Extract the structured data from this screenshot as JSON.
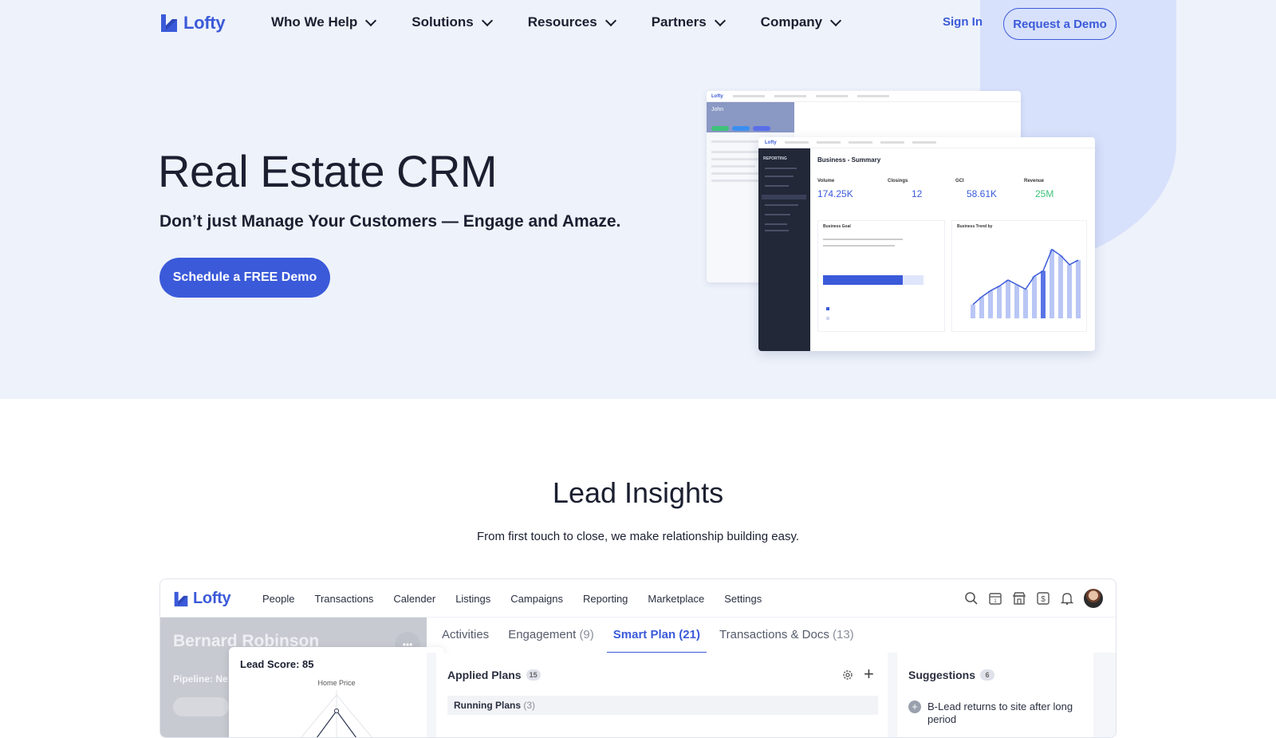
{
  "brand": {
    "name": "Lofty",
    "accent": "#3b5ad9",
    "hero_bg": "#eef2fa"
  },
  "nav": {
    "items": [
      {
        "label": "Who We Help"
      },
      {
        "label": "Solutions"
      },
      {
        "label": "Resources"
      },
      {
        "label": "Partners"
      },
      {
        "label": "Company"
      }
    ],
    "sign_in": "Sign In",
    "request_demo": "Request a Demo"
  },
  "hero": {
    "title": "Real Estate CRM",
    "subtitle": "Don’t just Manage Your Customers — Engage and Amaze.",
    "cta": "Schedule a FREE Demo",
    "mock": {
      "front_title": "Business - Summary",
      "kpis": [
        {
          "label": "Volume",
          "value": "174.25K"
        },
        {
          "label": "Closings",
          "value": "12"
        },
        {
          "label": "GCI",
          "value": "58.61K"
        },
        {
          "label": "Revenue",
          "value": "25M"
        }
      ],
      "back_name": "John",
      "sidebar_heading": "REPORTING",
      "goal_panel_title": "Business Goal",
      "trend_panel_title": "Business Trend by",
      "bar_heights": [
        0.18,
        0.28,
        0.36,
        0.42,
        0.5,
        0.44,
        0.38,
        0.55,
        0.62,
        0.9,
        0.82,
        0.7,
        0.76
      ]
    }
  },
  "section": {
    "title": "Lead Insights",
    "subtitle": "From first touch to close, we make relationship building easy."
  },
  "app": {
    "menu": [
      "People",
      "Transactions",
      "Calender",
      "Listings",
      "Campaigns",
      "Reporting",
      "Marketplace",
      "Settings"
    ],
    "profile_name": "Bernard Robinson",
    "pipeline": "Pipeline: Ne",
    "score_title": "Lead Score: 85",
    "score_axis": "Home Price",
    "tabs": [
      {
        "label": "Activities",
        "count": ""
      },
      {
        "label": "Engagement",
        "count": "(9)"
      },
      {
        "label": "Smart Plan (21)",
        "count": ""
      },
      {
        "label": "Transactions & Docs",
        "count": "(13)"
      }
    ],
    "applied_plans": "Applied Plans",
    "applied_count": "15",
    "running_plans": "Running Plans",
    "running_count": "(3)",
    "suggestions": "Suggestions",
    "suggestions_count": "6",
    "suggestion_item": "B-Lead returns to site after long period"
  }
}
